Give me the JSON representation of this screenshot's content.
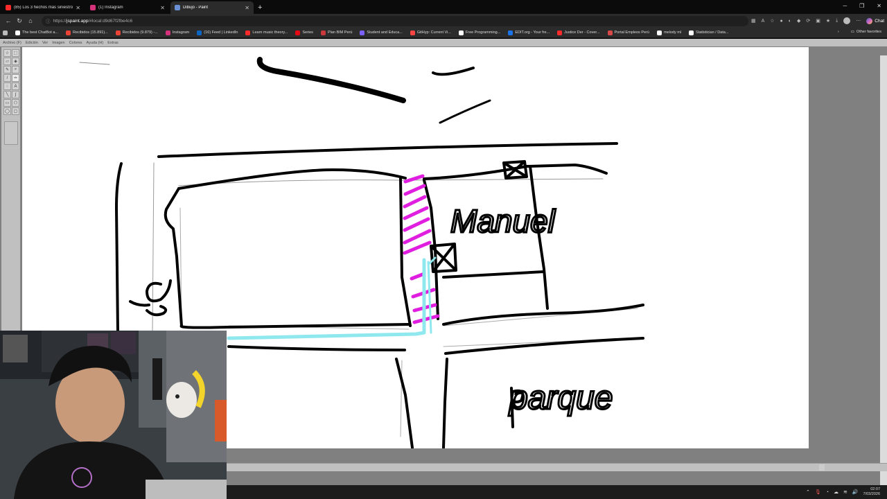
{
  "browser": {
    "tabs": [
      {
        "title": "(85) Los 3 hechos más siniestros y ",
        "favicon_color": "#ff2a2a",
        "active": false
      },
      {
        "title": "(1) Instagram",
        "favicon_color": "#d6327b",
        "active": false
      },
      {
        "title": "Dibujo - Paint",
        "favicon_color": "#6b8fd4",
        "active": true
      }
    ],
    "new_tab_symbol": "+",
    "address": {
      "prefix": "https://",
      "host": "jspaint.app",
      "path": "/#local:d9d67f2fbe4c6"
    },
    "chat_label": "Chat",
    "bookmarks": [
      {
        "label": "The best ChatBot a...",
        "color": "#ffffff"
      },
      {
        "label": "Recibidos (15.891)...",
        "color": "#ea4335"
      },
      {
        "label": "Recibidos (9.879) -...",
        "color": "#ea4335"
      },
      {
        "label": "Instagram",
        "color": "#d6327b"
      },
      {
        "label": "(16) Feed | LinkedIn",
        "color": "#0a66c2"
      },
      {
        "label": "Learn music theory...",
        "color": "#ff2a2a"
      },
      {
        "label": "Series",
        "color": "#e50914"
      },
      {
        "label": "Plan BIM Perú",
        "color": "#c9383a"
      },
      {
        "label": "Student and Educa...",
        "color": "#7b61ff"
      },
      {
        "label": "GitHyp: Current Vi...",
        "color": "#ff4444"
      },
      {
        "label": "Free Programming...",
        "color": "#ffffff"
      },
      {
        "label": "EDIT.org - Your fre...",
        "color": "#1a73e8"
      },
      {
        "label": "Justice Der - Cover...",
        "color": "#ff2a2a"
      },
      {
        "label": "Portal Empleos Perú",
        "color": "#d94848"
      },
      {
        "label": "melody ml",
        "color": "#ffffff"
      },
      {
        "label": "Statistician / Data...",
        "color": "#ffffff"
      }
    ],
    "other_favorites": "Other favorites"
  },
  "paint": {
    "menu": [
      "Archivo (F)",
      "Edición",
      "Ver",
      "Imagen",
      "Colores",
      "Ayuda (H)",
      "Extras"
    ],
    "tools": [
      "star-select",
      "rect-select",
      "eraser",
      "fill",
      "pick-color",
      "magnifier",
      "pencil",
      "brush",
      "airbrush",
      "text",
      "line",
      "curve",
      "rectangle",
      "polygon",
      "ellipse",
      "rounded-rect"
    ],
    "active_tool": "brush",
    "drawing_words": {
      "manuel": "Manuel",
      "parque": "parque"
    },
    "colors": {
      "stroke": "#000000",
      "route_magenta": "#e01ee0",
      "route_cyan": "#8fe8ee"
    }
  },
  "taskbar": {
    "time": "02:07",
    "date": "7/03/2026"
  }
}
